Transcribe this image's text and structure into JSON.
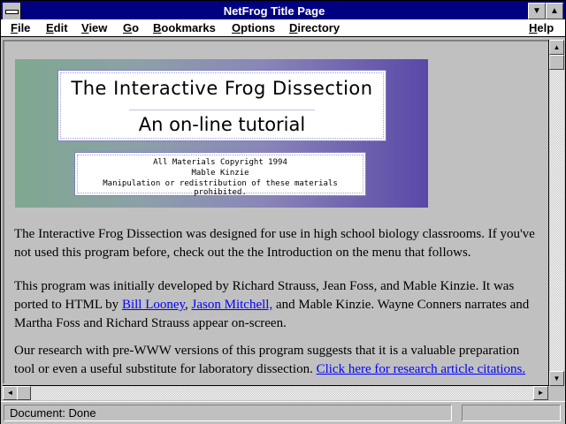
{
  "window": {
    "title": "NetFrog Title Page",
    "minimize_glyph": "▼",
    "maximize_glyph": "▲"
  },
  "menu": {
    "items": [
      {
        "key": "F",
        "rest": "ile"
      },
      {
        "key": "E",
        "rest": "dit"
      },
      {
        "key": "V",
        "rest": "iew"
      },
      {
        "key": "G",
        "rest": "o"
      },
      {
        "key": "B",
        "rest": "ookmarks"
      },
      {
        "key": "O",
        "rest": "ptions"
      },
      {
        "key": "D",
        "rest": "irectory"
      },
      {
        "key": "H",
        "rest": "elp"
      }
    ]
  },
  "banner": {
    "title": "The Interactive Frog Dissection",
    "subtitle": "An on-line tutorial",
    "copyright_line1": "All Materials Copyright 1994",
    "copyright_line2": "Mable Kinzie",
    "copyright_line3": "Manipulation or redistribution of these materials prohibited."
  },
  "content": {
    "para1": "The Interactive Frog Dissection was designed for use in high school biology classrooms. If you've not used this program before, check out the the Introduction on the menu that follows.",
    "para2_a": "This program was initially developed by Richard Strauss, Jean Foss, and Mable Kinzie. It was ported to HTML by ",
    "para2_link1": "Bill Looney",
    "para2_sep": ", ",
    "para2_link2": "Jason Mitchell,",
    "para2_b": " and Mable Kinzie. Wayne Conners narrates and Martha Foss and Richard Strauss appear on-screen.",
    "para3_a": "Our research with pre-WWW versions of this program suggests that it is a valuable preparation tool or even a useful substitute for laboratory dissection. ",
    "para3_link": "Click here for research article citations."
  },
  "scrollbars": {
    "up_glyph": "▲",
    "down_glyph": "▼",
    "left_glyph": "◄",
    "right_glyph": "►"
  },
  "status": {
    "text": "Document: Done"
  },
  "colors": {
    "titlebar": "#000080",
    "link": "#0000ff",
    "chrome": "#c0c0c0"
  }
}
